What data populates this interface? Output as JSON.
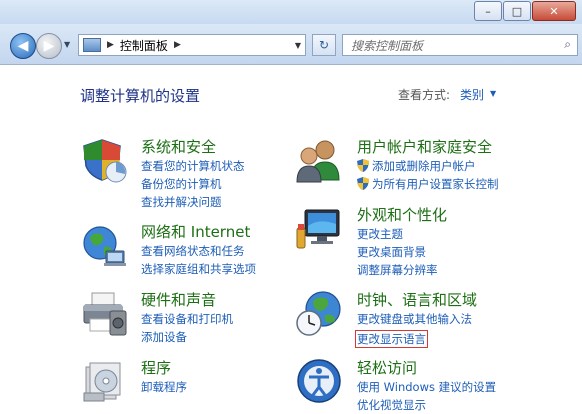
{
  "window": {
    "controls": [
      "–",
      "□",
      "✕"
    ]
  },
  "nav": {
    "breadcrumb": "控制面板",
    "search_placeholder": "搜索控制面板"
  },
  "header": {
    "title": "调整计算机的设置",
    "view_by_label": "查看方式:",
    "view_by_value": "类别"
  },
  "categories": [
    {
      "title": "系统和安全",
      "links": [
        "查看您的计算机状态",
        "备份您的计算机",
        "查找并解决问题"
      ]
    },
    {
      "title": "网络和 Internet",
      "links": [
        "查看网络状态和任务",
        "选择家庭组和共享选项"
      ]
    },
    {
      "title": "硬件和声音",
      "links": [
        "查看设备和打印机",
        "添加设备"
      ]
    },
    {
      "title": "程序",
      "links": [
        "卸载程序"
      ]
    },
    {
      "title": "用户帐户和家庭安全",
      "links": [
        "添加或删除用户帐户",
        "为所有用户设置家长控制"
      ]
    },
    {
      "title": "外观和个性化",
      "links": [
        "更改主题",
        "更改桌面背景",
        "调整屏幕分辨率"
      ]
    },
    {
      "title": "时钟、语言和区域",
      "links": [
        "更改键盘或其他输入法",
        "更改显示语言"
      ]
    },
    {
      "title": "轻松访问",
      "links": [
        "使用 Windows 建议的设置",
        "优化视觉显示"
      ]
    }
  ],
  "icons": {
    "system": "shield-chart-icon",
    "network": "globe-network-icon",
    "hardware": "printer-icon",
    "programs": "programs-box-icon",
    "users": "users-icon",
    "appearance": "monitor-paint-icon",
    "clock": "globe-clock-icon",
    "access": "ease-of-access-icon"
  },
  "colors": {
    "title_blue": "#1e3287",
    "category_green": "#1c6f14",
    "link_blue": "#1e5eb8",
    "highlight_red": "#d23a3a"
  }
}
